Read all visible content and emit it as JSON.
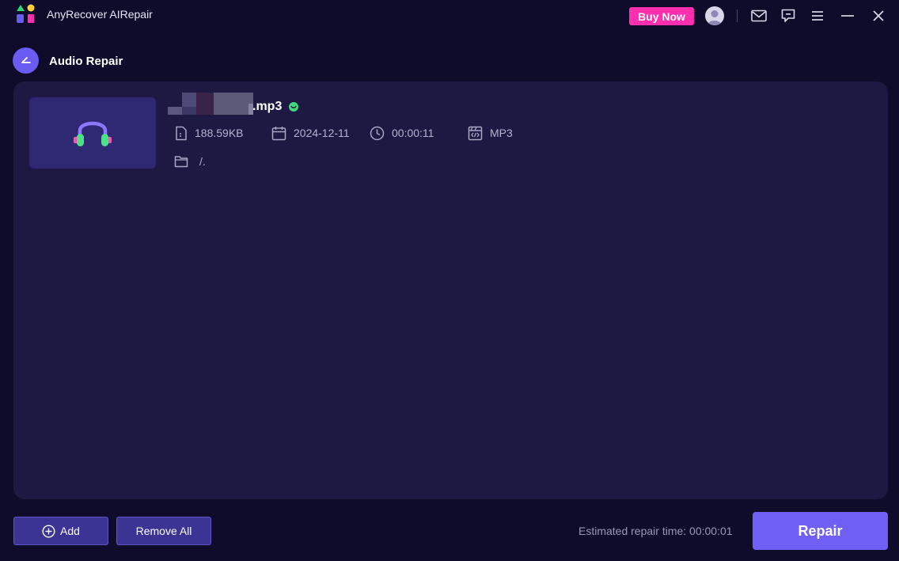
{
  "app": {
    "title": "AnyRecover AIRepair",
    "buy_now_label": "Buy Now"
  },
  "page": {
    "title": "Audio Repair"
  },
  "file": {
    "name_visible": ".mp3",
    "size": "188.59KB",
    "date": "2024-12-11",
    "duration": "00:00:11",
    "format": "MP3",
    "path": "/."
  },
  "footer": {
    "add_label": "Add",
    "remove_all_label": "Remove All",
    "estimated_time": "Estimated repair time: 00:00:01",
    "repair_label": "Repair"
  },
  "colors": {
    "background": "#0f0c2b",
    "panel": "#1e1943",
    "accent": "#6f5ff5",
    "buy_now": "#ff2fb0",
    "status_ok": "#3fd87a"
  },
  "icons": {
    "logo": "app-logo-icon",
    "back": "back-arrow-icon",
    "user": "user-avatar-icon",
    "mail": "mail-icon",
    "feedback": "chat-icon",
    "menu": "menu-icon",
    "minimize": "minimize-icon",
    "close": "close-icon",
    "file_size": "document-icon",
    "date": "calendar-icon",
    "duration": "clock-icon",
    "format": "film-code-icon",
    "folder": "folder-icon",
    "headphones": "headphones-icon",
    "status": "smile-status-icon",
    "add": "plus-circle-icon"
  }
}
